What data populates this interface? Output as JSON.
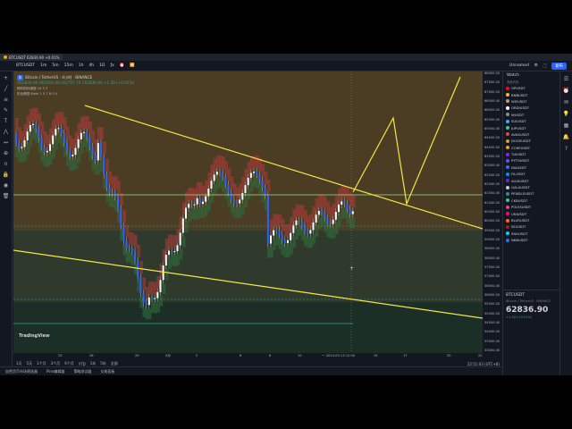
{
  "titlebar": {
    "tab_label": "BTCUSDT 62836.90 +0.01%"
  },
  "toolbar": {
    "symbol": "BTCUSDT",
    "intervals": [
      "1m",
      "5m",
      "15m",
      "1h",
      "4h",
      "1D"
    ],
    "right_label": "Unnamed",
    "publish_label": "发布"
  },
  "legend": {
    "symbol": "Bitcoin / TetherUS · 4小时 · BINANCE",
    "ohlc": "O62836.90 H62850.40 L62797.75 C62836.90 +1.50 (+0.01%)",
    "ind1": "随机指标缓慢 14 3 3",
    "ind2": "彩色蛋糕 Mark 1 0 7 8 0 0"
  },
  "logo": "TradingView",
  "price_axis": [
    "68000.00",
    "67500.00",
    "67000.00",
    "66500.00",
    "66000.00",
    "65500.00",
    "65000.00",
    "64500.00",
    "64000.00",
    "63500.00",
    "63000.00",
    "62500.00",
    "62000.00",
    "61500.00",
    "61000.00",
    "60500.00",
    "60000.00",
    "59500.00",
    "59000.00",
    "58500.00",
    "58000.00",
    "57500.00",
    "57000.00",
    "56500.00",
    "56000.00",
    "55500.00",
    "55000.00",
    "54500.00",
    "54000.00",
    "53500.00",
    "53000.00"
  ],
  "time_axis": [
    "22",
    "26",
    "29",
    "5月",
    "2",
    "6",
    "8",
    "10",
    "一 2024-05-13 12:00",
    "15",
    "17",
    "20",
    "22"
  ],
  "bottom": {
    "ranges": [
      "1天",
      "5天",
      "1个月",
      "3个月",
      "6个月",
      "YTD",
      "1年",
      "5年",
      "全部"
    ],
    "clock": "22:51:03 (UTC+8)"
  },
  "panel_tabs": [
    "加密货币市场筛选器",
    "Pine编辑器",
    "策略测试器",
    "交易面板"
  ],
  "watch": {
    "title": "Watch",
    "col": "商品代码",
    "items": [
      {
        "sym": "OPUSDT",
        "color": "#ff0420"
      },
      {
        "sym": "BNBUSDT",
        "color": "#f3ba2f"
      },
      {
        "sym": "WIFUSDT",
        "color": "#c49a6c"
      },
      {
        "sym": "ORDIUSDT",
        "color": "#ffffff"
      },
      {
        "sym": "WUSDT",
        "color": "#8a8a8a"
      },
      {
        "sym": "SUIUSDT",
        "color": "#4da2ff"
      },
      {
        "sym": "JUPUSDT",
        "color": "#36c9a6"
      },
      {
        "sym": "AVAXUSDT",
        "color": "#e84142"
      },
      {
        "sym": "DOGEUSDT",
        "color": "#c2a633"
      },
      {
        "sym": "COREUSDT",
        "color": "#f79a1b"
      },
      {
        "sym": "TIAUSDT",
        "color": "#7b2bf9"
      },
      {
        "sym": "PYTHUSDT",
        "color": "#6b4ee6"
      },
      {
        "sym": "DIAUSDT",
        "color": "#3d6fe0"
      },
      {
        "sym": "FILUSDT",
        "color": "#0090ff"
      },
      {
        "sym": "AGIXUSDT",
        "color": "#5b2ee0"
      },
      {
        "sym": "GALAUSDT",
        "color": "#cccccc"
      },
      {
        "sym": "PENDLEUSDT",
        "color": "#3b82a0"
      },
      {
        "sym": "CKBUSDT",
        "color": "#3cc68a"
      },
      {
        "sym": "POLYXUSDT",
        "color": "#ec4673"
      },
      {
        "sym": "UNIUSDT",
        "color": "#ff007a"
      },
      {
        "sym": "BLURUSDT",
        "color": "#ff6d00"
      },
      {
        "sym": "SEIUSDT",
        "color": "#9b1c2e"
      },
      {
        "sym": "SNXUSDT",
        "color": "#00d1ff"
      },
      {
        "sym": "NKNUSDT",
        "color": "#2b6ce6"
      }
    ],
    "detail": {
      "symbol": "BTCUSDT",
      "sub": "Bitcoin / TetherUS · BINANCE",
      "price": "62836.90",
      "change": "+1.50 (+0.01%)"
    }
  },
  "colors": {
    "up": "#26a69a",
    "down": "#ef5350",
    "trendline": "#f5e642",
    "cloud_red": "#b23a3a",
    "cloud_green": "#2e6b3a"
  }
}
